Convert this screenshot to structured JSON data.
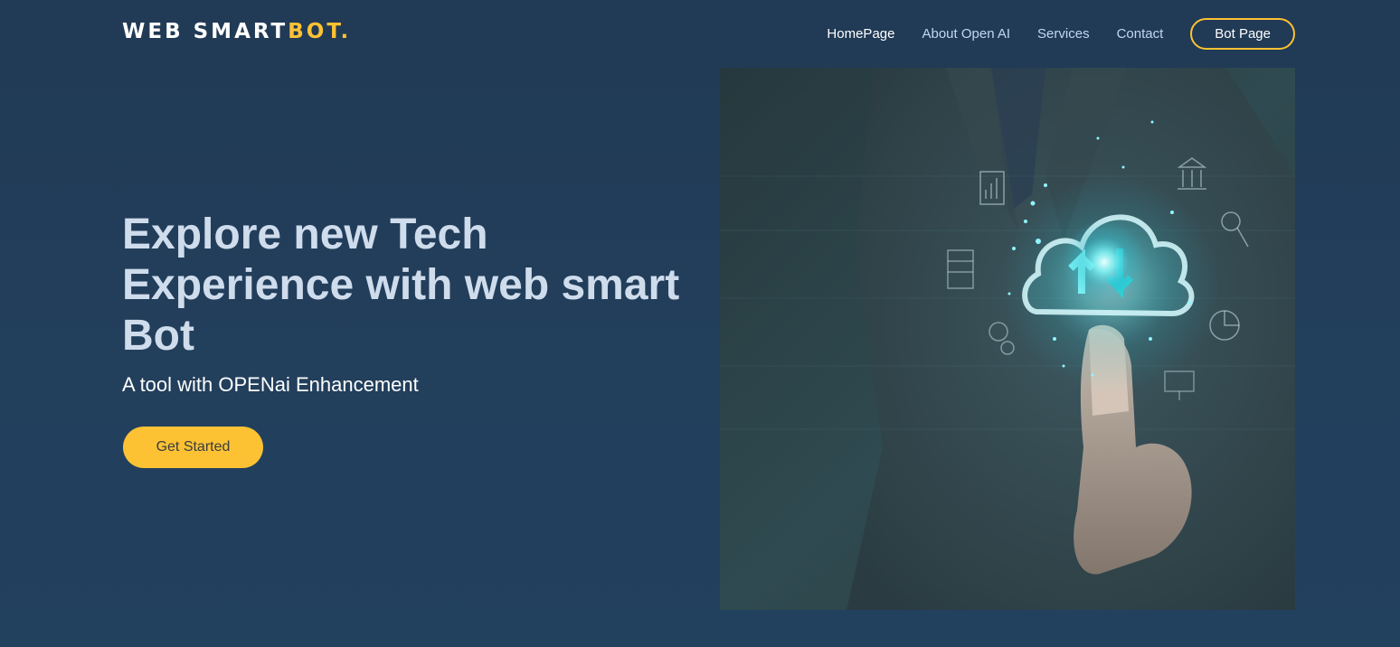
{
  "brand": {
    "name_main": "WEB SMART",
    "name_accent": "BOT."
  },
  "nav": {
    "items": [
      {
        "label": "HomePage",
        "active": true
      },
      {
        "label": "About Open AI",
        "active": false
      },
      {
        "label": "Services",
        "active": false
      },
      {
        "label": "Contact",
        "active": false
      }
    ],
    "bot_button_label": "Bot Page"
  },
  "hero": {
    "title": "Explore new Tech Experience with web smart Bot",
    "subtitle": "A tool with OPENai Enhancement",
    "cta_label": "Get Started",
    "image_icon": "cloud-touch-illustration"
  },
  "colors": {
    "background": "#223f5c",
    "accent": "#fcc233",
    "title_text": "#cfdcec",
    "nav_text": "#c3d7ee"
  }
}
